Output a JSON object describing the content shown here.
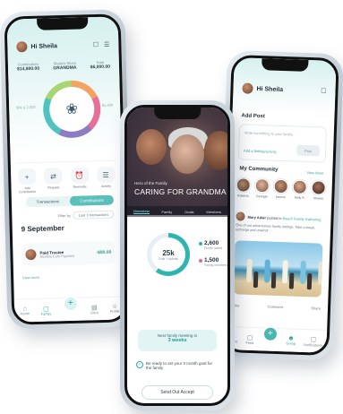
{
  "left_phone": {
    "greeting": "Hi Sheila",
    "stats": [
      {
        "key": "Contributions",
        "value": "$14,800.00"
      },
      {
        "key": "Sheila's Share",
        "value": "GRANDMA"
      },
      {
        "key": "Total",
        "value": "$6,000.00"
      }
    ],
    "side_left": "$3k & 2,000",
    "side_right": "$1,400",
    "actions": [
      "Add Contribution",
      "Request",
      "Reminder",
      "Activity"
    ],
    "toggle": [
      "Transactions",
      "Contributions"
    ],
    "filter_label": "Filter by",
    "filter_value": "Last 3 transactions",
    "date": "9 September",
    "entry_name": "Paid Trustee",
    "entry_sub": "Monthly Care Payment",
    "entry_amount": "-$80.00",
    "view_more": "View more",
    "nav": [
      "Home",
      "Family",
      "",
      "Docs",
      "Profile"
    ]
  },
  "center_phone": {
    "hero_subtitle": "Hero of the Family",
    "hero_title": "CARING FOR GRANDMA",
    "tabs": [
      "Overview",
      "Family",
      "Goals",
      "Members"
    ],
    "donut_value": "25k",
    "donut_label": "Goal + Activity",
    "legend": [
      {
        "value": "2,600",
        "label": "Funds raised",
        "color": "#2fb5b0"
      },
      {
        "value": "1,500",
        "label": "Family members",
        "color": "#e06a8a"
      }
    ],
    "banner_line1": "Next family meeting in",
    "banner_line2": "3 weeks",
    "note": "Be ready to set your 3 month goal for the family",
    "send_button": "Send Out Accept"
  },
  "right_phone": {
    "greeting": "Hi Sheila",
    "add_post": "Add Post",
    "post_placeholder": "Write something to your family...",
    "feeling_link": "Add a feeling/activity",
    "post_button": "Post",
    "community_title": "My Community",
    "view_more": "View More",
    "members": [
      "Roberto",
      "Georgia",
      "Dennis",
      "Kelly R",
      "Sharon"
    ],
    "post_author": "Mary Adair",
    "post_action": "posted in",
    "post_group": "Beach Family Gathering",
    "post_body": "One of our adventurous family outings. Take a break, recharge and unwind!",
    "reactions": [
      "Like",
      "Comment",
      "Share"
    ],
    "nav": [
      "Home",
      "Feed",
      "",
      "Group",
      "Notifications"
    ]
  }
}
